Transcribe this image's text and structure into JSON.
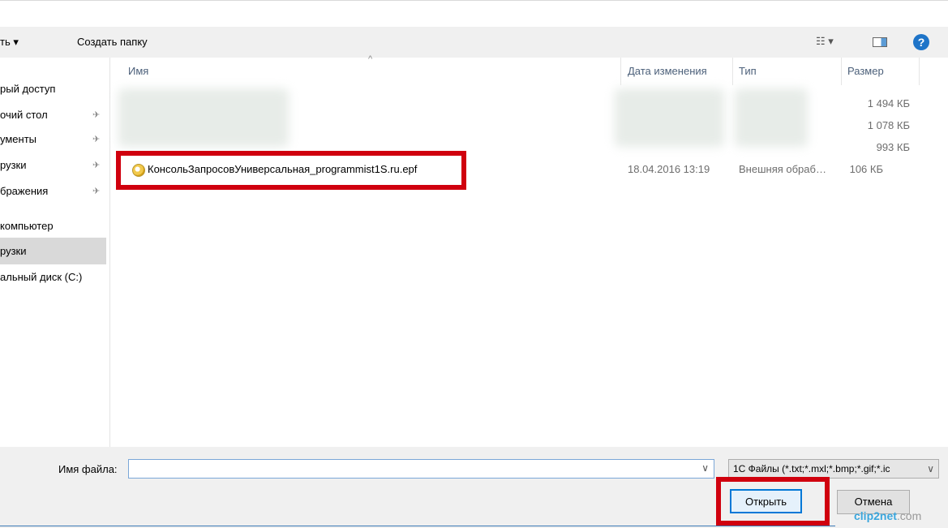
{
  "toolbar": {
    "organize_label": "ть ▾",
    "new_folder_label": "Создать папку",
    "views_label": "☷ ▾",
    "help_label": "?"
  },
  "nav": {
    "items": [
      {
        "label": "рый доступ",
        "pinned": false
      },
      {
        "label": "очий стол",
        "pinned": true
      },
      {
        "label": "ументы",
        "pinned": true
      },
      {
        "label": "рузки",
        "pinned": true
      },
      {
        "label": "бражения",
        "pinned": true
      },
      {
        "label": "компьютер",
        "pinned": false
      },
      {
        "label": "рузки",
        "pinned": false,
        "selected": true
      },
      {
        "label": "альный диск (C:)",
        "pinned": false
      }
    ],
    "pin_glyph": "✈"
  },
  "columns": {
    "name": "Имя",
    "date": "Дата изменения",
    "type": "Тип",
    "size": "Размер",
    "sort_glyph": "^"
  },
  "files": [
    {
      "name": "",
      "date": "",
      "type": "",
      "size": "1 494 КБ",
      "blurred": true
    },
    {
      "name": "",
      "date": "",
      "type": "",
      "size": "1 078 КБ",
      "blurred": true
    },
    {
      "name": "",
      "date": "",
      "type": "",
      "size": "993 КБ",
      "blurred": true
    },
    {
      "name": "КонсольЗапросовУниверсальная_programmist1S.ru.epf",
      "date": "18.04.2016 13:19",
      "type": "Внешняя обраб…",
      "size": "106 КБ",
      "blurred": false
    }
  ],
  "bottom": {
    "filename_label": "Имя файла:",
    "filename_value": "",
    "filter_value": "1С Файлы (*.txt;*.mxl;*.bmp;*.gif;*.ic",
    "open_label": "Открыть",
    "cancel_label": "Отмена",
    "dropdown_glyph": "∨"
  },
  "watermark": {
    "main": "clip2net",
    "suffix": ".com"
  },
  "colors": {
    "highlight": "#d0000e",
    "accent": "#0078d7"
  }
}
